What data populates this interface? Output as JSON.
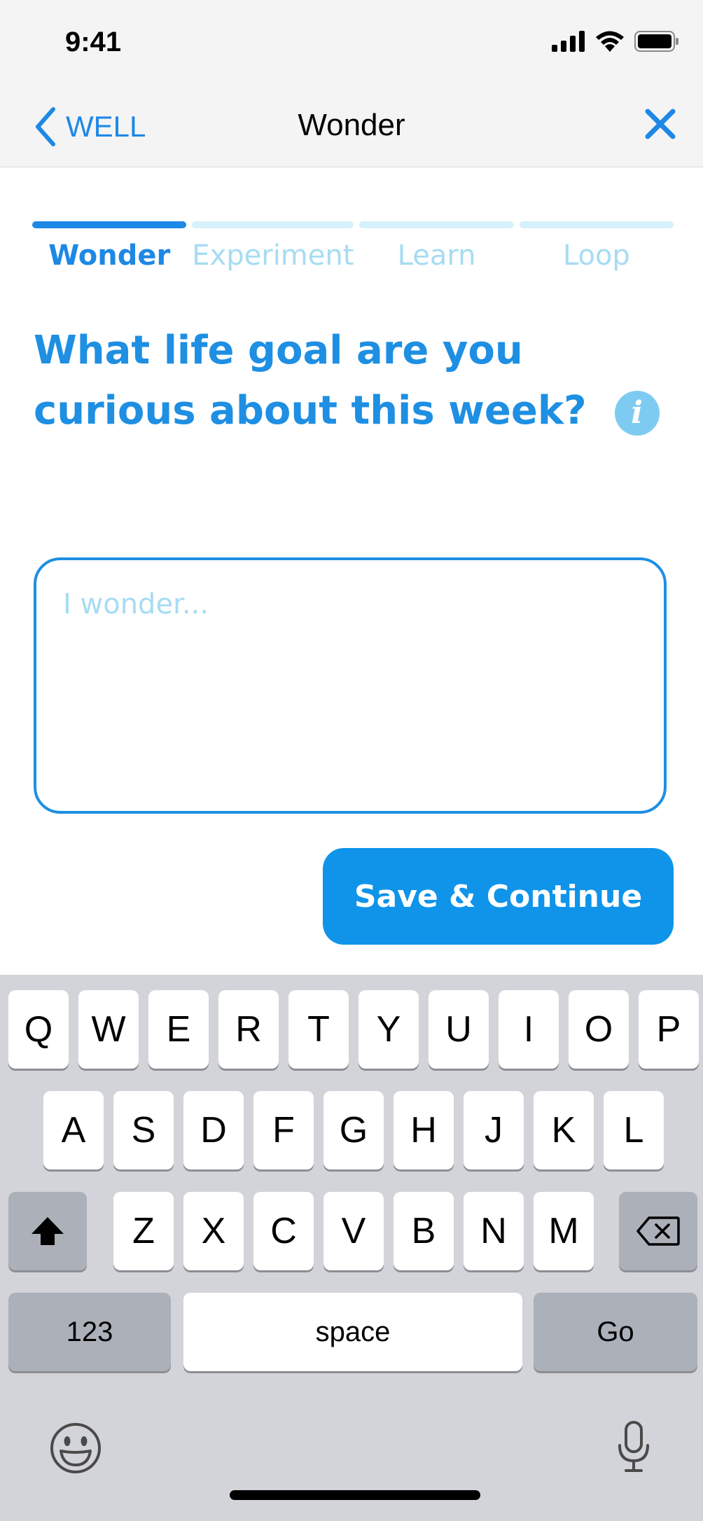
{
  "status": {
    "time": "9:41"
  },
  "nav": {
    "back_label": "WELL",
    "title": "Wonder"
  },
  "stepper": {
    "steps": [
      {
        "label": "Wonder",
        "active": true
      },
      {
        "label": "Experiment",
        "active": false
      },
      {
        "label": "Learn",
        "active": false
      },
      {
        "label": "Loop",
        "active": false
      }
    ]
  },
  "question": {
    "text": "What life goal are you curious about this week?"
  },
  "input": {
    "placeholder": "I wonder...",
    "value": ""
  },
  "actions": {
    "save_label": "Save & Continue"
  },
  "keyboard": {
    "row1": [
      "Q",
      "W",
      "E",
      "R",
      "T",
      "Y",
      "U",
      "I",
      "O",
      "P"
    ],
    "row2": [
      "A",
      "S",
      "D",
      "F",
      "G",
      "H",
      "J",
      "K",
      "L"
    ],
    "row3": [
      "Z",
      "X",
      "C",
      "V",
      "B",
      "N",
      "M"
    ],
    "numbers_label": "123",
    "space_label": "space",
    "go_label": "Go"
  },
  "colors": {
    "accent": "#1e8fe2",
    "accent_light": "#a6dcf2",
    "button": "#0f94ea",
    "keyboard_bg": "#d2d4d9"
  },
  "icons": [
    "signal-icon",
    "wifi-icon",
    "battery-icon",
    "chevron-left-icon",
    "close-icon",
    "info-icon",
    "shift-icon",
    "backspace-icon",
    "emoji-icon",
    "microphone-icon"
  ]
}
